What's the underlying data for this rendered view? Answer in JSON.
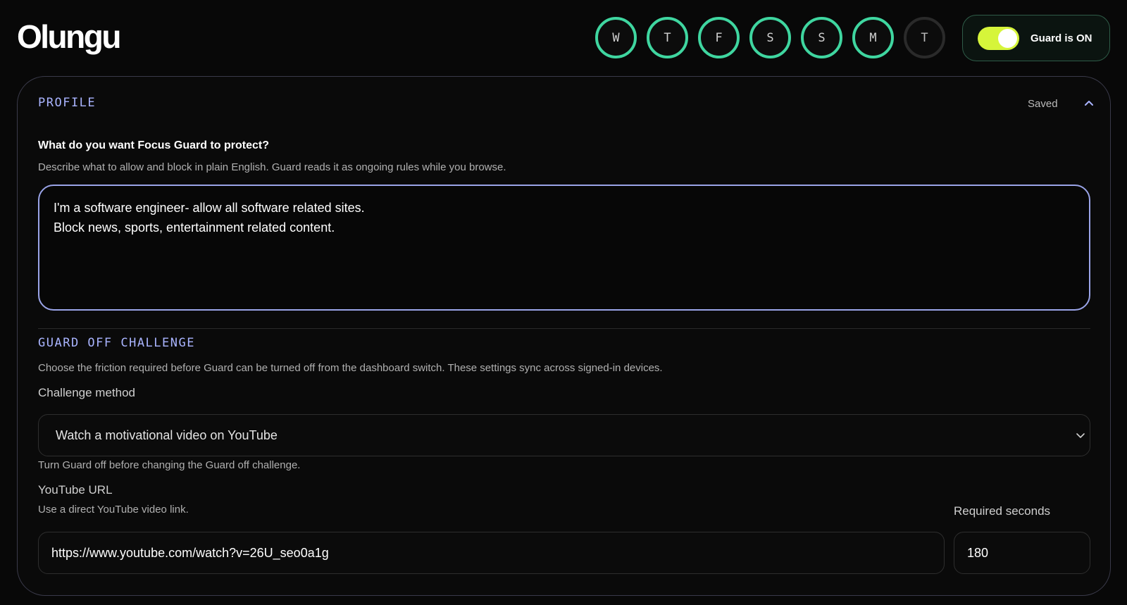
{
  "app": {
    "logo": "Olungu"
  },
  "streak": {
    "days": [
      {
        "letter": "W",
        "active": true
      },
      {
        "letter": "T",
        "active": true
      },
      {
        "letter": "F",
        "active": true
      },
      {
        "letter": "S",
        "active": true
      },
      {
        "letter": "S",
        "active": true
      },
      {
        "letter": "M",
        "active": true
      },
      {
        "letter": "T",
        "active": false
      }
    ],
    "active_color": "#3fd6a0"
  },
  "guard": {
    "status_label": "Guard is ON",
    "on": true,
    "switch_color": "#d6f53a"
  },
  "profile": {
    "section_title": "PROFILE",
    "saved_label": "Saved",
    "question": "What do you want Focus Guard to protect?",
    "hint": "Describe what to allow and block in plain English. Guard reads it as ongoing rules while you browse.",
    "rules_text": "I'm a software engineer- allow all software related sites.\nBlock news, sports, entertainment related content."
  },
  "challenge": {
    "section_title": "GUARD OFF CHALLENGE",
    "description": "Choose the friction required before Guard can be turned off from the dashboard switch. These settings sync across signed-in devices.",
    "method_label": "Challenge method",
    "method_value": "Watch a motivational video on YouTube",
    "locked_note": "Turn Guard off before changing the Guard off challenge.",
    "youtube_label": "YouTube URL",
    "youtube_hint": "Use a direct YouTube video link.",
    "youtube_url": "https://www.youtube.com/watch?v=26U_seo0a1g",
    "seconds_label": "Required seconds",
    "seconds_value": "180"
  },
  "colors": {
    "accent": "#a9b4ff",
    "background": "#080808"
  }
}
